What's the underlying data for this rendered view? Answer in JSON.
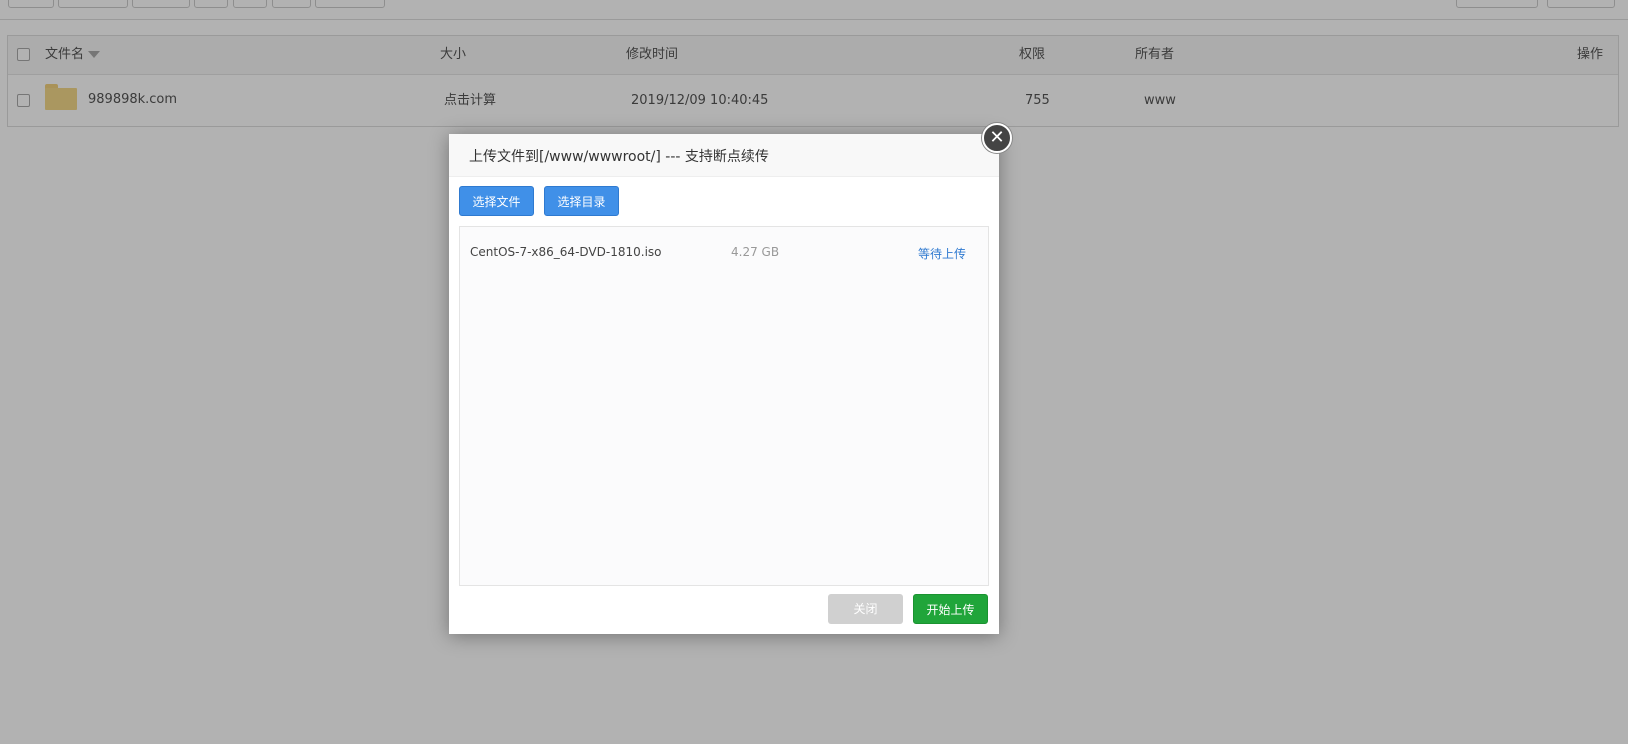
{
  "file_table": {
    "headers": {
      "name": "文件名",
      "size": "大小",
      "modified": "修改时间",
      "permissions": "权限",
      "owner": "所有者",
      "actions": "操作"
    },
    "rows": [
      {
        "name": "989898k.com",
        "size": "点击计算",
        "modified": "2019/12/09 10:40:45",
        "permissions": "755",
        "owner": "www"
      }
    ]
  },
  "dialog": {
    "title": "上传文件到[/www/wwwroot/] --- 支持断点续传",
    "select_file_label": "选择文件",
    "select_dir_label": "选择目录",
    "files": [
      {
        "name": "CentOS-7-x86_64-DVD-1810.iso",
        "size": "4.27 GB",
        "status": "等待上传"
      }
    ],
    "close_label": "关闭",
    "start_upload_label": "开始上传"
  },
  "colors": {
    "primary_blue": "#4090e8",
    "success_green": "#20a53a",
    "status_link": "#2f7ad0"
  }
}
